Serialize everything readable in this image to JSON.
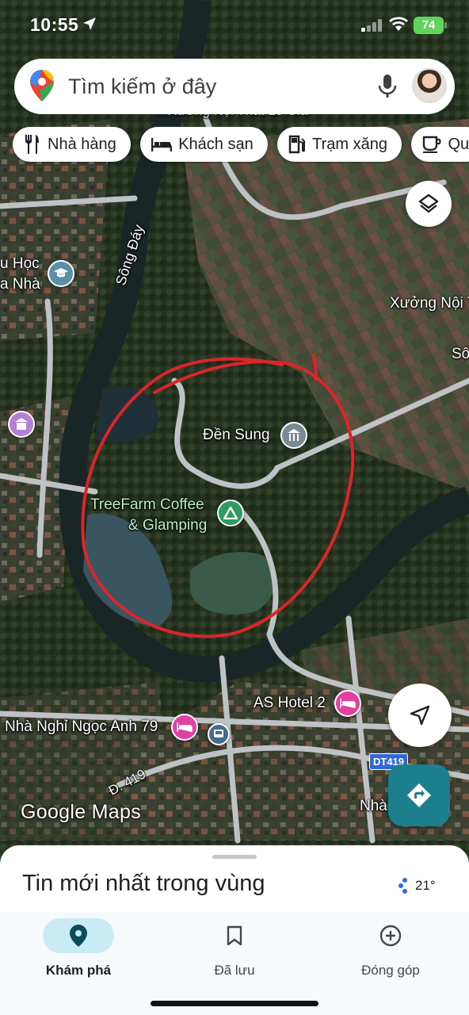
{
  "status_bar": {
    "time": "10:55",
    "battery": "74"
  },
  "search": {
    "placeholder": "Tìm kiếm ở đây"
  },
  "chips": [
    {
      "label": "Nhà hàng",
      "icon": "restaurant-icon"
    },
    {
      "label": "Khách sạn",
      "icon": "hotel-icon"
    },
    {
      "label": "Trạm xăng",
      "icon": "gas-station-icon"
    },
    {
      "label": "Qu",
      "icon": "coffee-icon"
    }
  ],
  "map": {
    "labels": {
      "top_partial": "Xưởng Nội Thất Lê Gia",
      "school": "u Học",
      "school2": "a Nhà",
      "river": "Sông Đáy",
      "xuong": "Xưởng Nội T",
      "song_right": "Sô",
      "den_sung": "Đền Sung",
      "treefarm_1": "TreeFarm Coffee",
      "treefarm_2": "& Glamping",
      "as_hotel": "AS Hotel 2",
      "nha_nghi": "Nhà Nghỉ Ngọc Anh 79",
      "dt419": "DT419",
      "d419": "Đ. 419",
      "nha_right": "Nhà",
      "logo": "Google Maps"
    }
  },
  "sheet": {
    "title": "Tin mới nhất trong vùng",
    "temperature": "21°"
  },
  "nav": [
    {
      "label": "Khám phá",
      "icon": "explore-pin-icon",
      "active": true
    },
    {
      "label": "Đã lưu",
      "icon": "bookmark-icon",
      "active": false
    },
    {
      "label": "Đóng góp",
      "icon": "add-circle-icon",
      "active": false
    }
  ],
  "colors": {
    "accent": "#1b7f8e",
    "annotation_circle": "#d8262b",
    "poi_lodging": "#e040a0",
    "poi_park": "#2e9b5f"
  }
}
